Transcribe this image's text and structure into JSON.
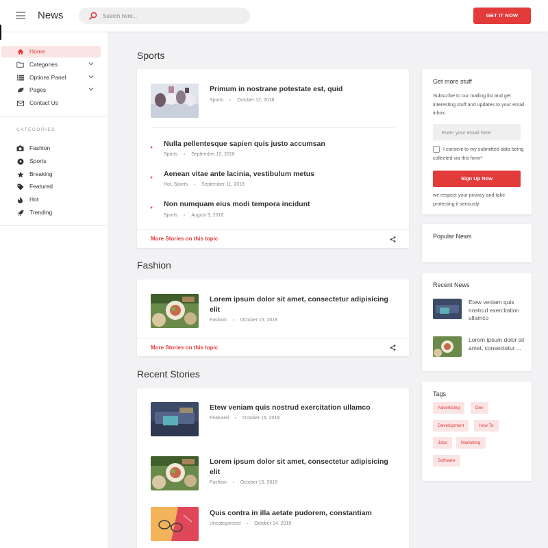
{
  "header": {
    "brand": "News",
    "search_placeholder": "Search here...",
    "cta_label": "GET IT NOW"
  },
  "sidebar": {
    "nav": [
      {
        "label": "Home",
        "icon": "home-icon",
        "active": true
      },
      {
        "label": "Categories",
        "icon": "folder-icon",
        "has_children": true
      },
      {
        "label": "Options Panel",
        "icon": "list-icon",
        "has_children": true
      },
      {
        "label": "Pages",
        "icon": "leaf-icon",
        "has_children": true
      },
      {
        "label": "Contact Us",
        "icon": "envelope-icon"
      }
    ],
    "categories_heading": "CATEGORIES",
    "categories": [
      {
        "label": "Fashion",
        "icon": "camera-icon"
      },
      {
        "label": "Sports",
        "icon": "soccer-ball-icon"
      },
      {
        "label": "Breaking",
        "icon": "star-icon"
      },
      {
        "label": "Featured",
        "icon": "tag-icon"
      },
      {
        "label": "Hot",
        "icon": "fire-icon"
      },
      {
        "label": "Trending",
        "icon": "rocket-icon"
      }
    ]
  },
  "sports": {
    "title": "Sports",
    "featured": {
      "title": "Primum in nostrane potestate est, quid",
      "category": "Sports",
      "date": "October 12, 2018"
    },
    "list": [
      {
        "title": "Nulla pellentesque sapien quis justo accumsan",
        "category": "Sports",
        "date": "September 12, 2018"
      },
      {
        "title": "Aenean vitae ante lacinia, vestibulum metus",
        "category": "Hot, Sports",
        "date": "September 11, 2018"
      },
      {
        "title": "Non numquam eius modi tempora incidunt",
        "category": "Sports",
        "date": "August 9, 2018"
      }
    ],
    "more_label": "More Stories on this topic"
  },
  "fashion": {
    "title": "Fashion",
    "featured": {
      "title": "Lorem ipsum dolor sit amet, consectetur adipisicing elit",
      "category": "Fashion",
      "date": "October 15, 2018"
    },
    "more_label": "More Stories on this topic"
  },
  "recent_stories": {
    "title": "Recent Stories",
    "items": [
      {
        "title": "Etew veniam quis nostrud exercitation ullamco",
        "category": "Featured",
        "date": "October 16, 2018"
      },
      {
        "title": "Lorem ipsum dolor sit amet, consectetur adipisicing elit",
        "category": "Fashion",
        "date": "October 15, 2018"
      },
      {
        "title": "Quis contra in illa aetate pudorem, constantiam",
        "category": "Uncategorized",
        "date": "October 14, 2018"
      }
    ]
  },
  "newsletter": {
    "title": "Get more stuff",
    "text": "Subscribe to our mailing list and get interesting stuff and updates to your email inbox.",
    "email_placeholder": "Enter your email here",
    "consent_text": "I consent to my submitted data being collected via this form*",
    "button_label": "Sign Up Now",
    "privacy_text": "we respect your privacy and take protecting it seriously"
  },
  "popular_news": {
    "title": "Popular News"
  },
  "recent_news": {
    "title": "Recent News",
    "items": [
      {
        "title": "Etew veniam quis nostrud exercitation ullamco"
      },
      {
        "title": "Lorem ipsum dolor sit amet, consectetur ..."
      }
    ]
  },
  "tags": {
    "title": "Tags",
    "items": [
      "Advertising",
      "Dev",
      "Development",
      "How To",
      "Jobs",
      "Marketing",
      "Software"
    ]
  },
  "colors": {
    "accent": "#e33a3a",
    "accent_light": "#fbe4e4",
    "background": "#f2f2f4"
  }
}
